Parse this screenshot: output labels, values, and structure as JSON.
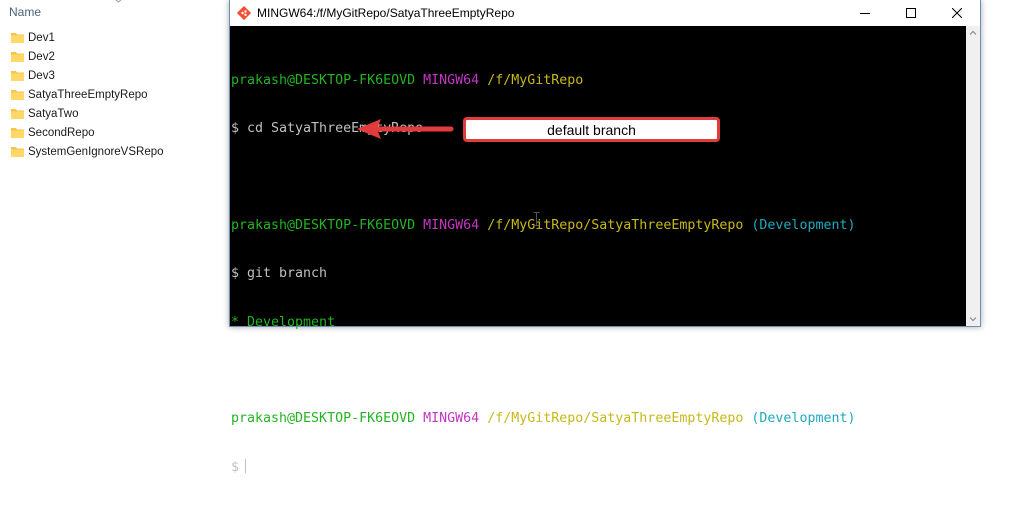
{
  "explorer": {
    "name_header": "Name",
    "folders": [
      "Dev1",
      "Dev2",
      "Dev3",
      "SatyaThreeEmptyRepo",
      "SatyaTwo",
      "SecondRepo",
      "SystemGenIgnoreVSRepo"
    ]
  },
  "window": {
    "title": "MINGW64:/f/MyGitRepo/SatyaThreeEmptyRepo"
  },
  "terminal": {
    "prompt1": {
      "user": "prakash@DESKTOP-FK6EOVD",
      "env": "MINGW64",
      "path": "/f/MyGitRepo",
      "branch": ""
    },
    "cmd1": "$ cd SatyaThreeEmptyRepo",
    "prompt2": {
      "user": "prakash@DESKTOP-FK6EOVD",
      "env": "MINGW64",
      "path": "/f/MyGitRepo/SatyaThreeEmptyRepo",
      "branch": "(Development)"
    },
    "cmd2": "$ git branch",
    "branch_output": "* Development",
    "prompt3": {
      "user": "prakash@DESKTOP-FK6EOVD",
      "env": "MINGW64",
      "path": "/f/MyGitRepo/SatyaThreeEmptyRepo",
      "branch": "(Development)"
    },
    "current_prompt": "$"
  },
  "annotation": {
    "label": "default branch",
    "color": "#e23b3b"
  },
  "colors": {
    "terminal_bg": "#000000",
    "user": "#24b324",
    "env": "#c336c3",
    "path": "#c6b91a",
    "branch": "#20a8c0"
  }
}
